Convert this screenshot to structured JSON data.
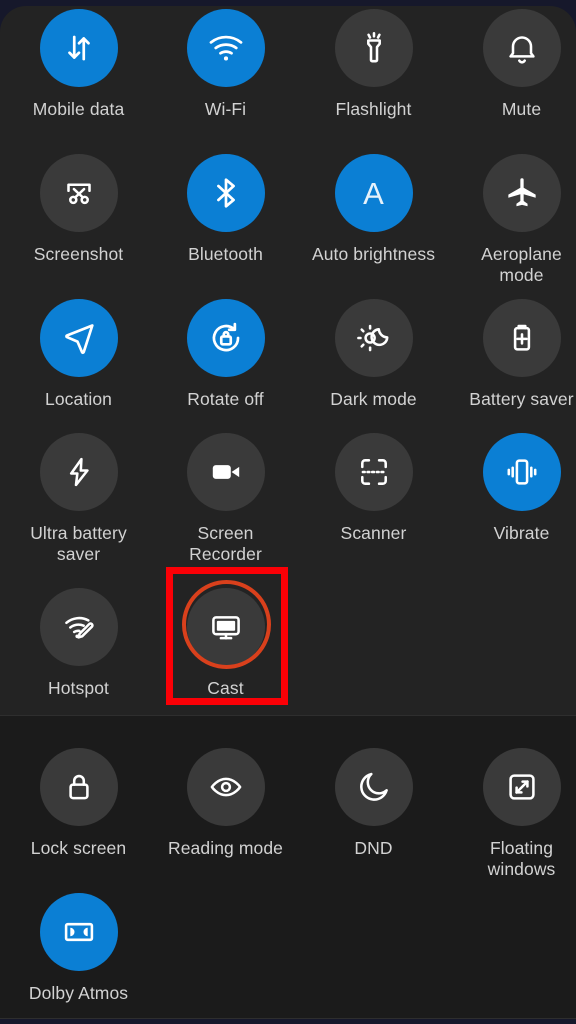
{
  "theme": {
    "background": "#16182b",
    "panel_top_bg": "#232323",
    "panel_bottom_bg": "#1b1b1b",
    "tile_off_bg": "#3a3a3a",
    "tile_on_bg": "#0b7fd4",
    "label_color": "#d2d2d2",
    "highlight_box_color": "#fb0006",
    "highlight_ring_color": "#d9401c"
  },
  "quick_settings": {
    "primary_tiles": [
      {
        "label": "Mobile data",
        "icon": "mobile-data-icon",
        "state": "on",
        "row": 0,
        "col": 0
      },
      {
        "label": "Wi-Fi",
        "icon": "wifi-icon",
        "state": "on",
        "row": 0,
        "col": 1
      },
      {
        "label": "Flashlight",
        "icon": "flashlight-icon",
        "state": "off",
        "row": 0,
        "col": 2
      },
      {
        "label": "Mute",
        "icon": "bell-icon",
        "state": "off",
        "row": 0,
        "col": 3
      },
      {
        "label": "Screenshot",
        "icon": "screenshot-icon",
        "state": "off",
        "row": 1,
        "col": 0
      },
      {
        "label": "Bluetooth",
        "icon": "bluetooth-icon",
        "state": "on",
        "row": 1,
        "col": 1
      },
      {
        "label": "Auto brightness",
        "icon": "auto-brightness-icon",
        "state": "on",
        "row": 1,
        "col": 2
      },
      {
        "label": "Aeroplane\nmode",
        "icon": "airplane-icon",
        "state": "off",
        "row": 1,
        "col": 3
      },
      {
        "label": "Location",
        "icon": "location-arrow-icon",
        "state": "on",
        "row": 2,
        "col": 0
      },
      {
        "label": "Rotate off",
        "icon": "rotate-lock-icon",
        "state": "on",
        "row": 2,
        "col": 1
      },
      {
        "label": "Dark mode",
        "icon": "dark-mode-icon",
        "state": "off",
        "row": 2,
        "col": 2
      },
      {
        "label": "Battery saver",
        "icon": "battery-plus-icon",
        "state": "off",
        "row": 2,
        "col": 3
      },
      {
        "label": "Ultra battery\nsaver",
        "icon": "bolt-icon",
        "state": "off",
        "row": 3,
        "col": 0
      },
      {
        "label": "Screen\nRecorder",
        "icon": "video-camera-icon",
        "state": "off",
        "row": 3,
        "col": 1
      },
      {
        "label": "Scanner",
        "icon": "scanner-icon",
        "state": "off",
        "row": 3,
        "col": 2
      },
      {
        "label": "Vibrate",
        "icon": "vibrate-icon",
        "state": "on",
        "row": 3,
        "col": 3
      },
      {
        "label": "Hotspot",
        "icon": "hotspot-icon",
        "state": "off",
        "row": 4,
        "col": 0
      },
      {
        "label": "Cast",
        "icon": "cast-screen-icon",
        "state": "off",
        "row": 4,
        "col": 1
      }
    ],
    "secondary_tiles": [
      {
        "label": "Lock screen",
        "icon": "lock-icon",
        "state": "off",
        "row": 0,
        "col": 0
      },
      {
        "label": "Reading mode",
        "icon": "eye-icon",
        "state": "off",
        "row": 0,
        "col": 1
      },
      {
        "label": "DND",
        "icon": "moon-icon",
        "state": "off",
        "row": 0,
        "col": 2
      },
      {
        "label": "Floating\nwindows",
        "icon": "floating-windows-icon",
        "state": "off",
        "row": 0,
        "col": 3
      },
      {
        "label": "Dolby Atmos",
        "icon": "dolby-atmos-icon",
        "state": "on",
        "row": 1,
        "col": 0
      }
    ]
  },
  "highlight": {
    "target_label": "Cast",
    "shape": "rectangle-with-circle"
  }
}
